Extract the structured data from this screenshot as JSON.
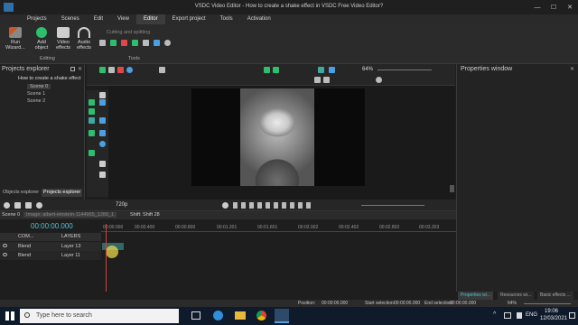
{
  "window": {
    "title": "VSDC Video Editor - How to create a shake effect in VSDC Free Video Editor?",
    "minimize": "—",
    "maximize": "☐",
    "close": "✕"
  },
  "menu": [
    "Projects",
    "Scenes",
    "Edit",
    "View",
    "Editor",
    "Export project",
    "Tools",
    "Activation"
  ],
  "ribbon": {
    "run_wizard": "Run\nWizard...",
    "add_object": "Add\nobject",
    "video_effects": "Video\neffects",
    "audio_effects": "Audio\neffects",
    "group_editing": "Editing",
    "cutting_splitting": "Cutting and splitting",
    "group_tools": "Tools"
  },
  "projects_explorer": {
    "title": "Projects explorer",
    "project": "How to create a shake effect",
    "scenes": [
      "Scene 0",
      "Scene 1",
      "Scene 2"
    ],
    "tabs": [
      "Objects explorer",
      "Projects explorer"
    ]
  },
  "properties": {
    "title": "Properties window"
  },
  "preview": {
    "zoom": "64%",
    "quality": "720p"
  },
  "timeline": {
    "breadcrumb": [
      "Scene 0",
      "Image: albert-einstein-1144965_1280_1",
      "Shift: Shift 28"
    ],
    "time": "00:00:00.000",
    "header_com": "COM...",
    "header_layers": "LAYERS",
    "ruler": [
      "00:00.000",
      "00:00.400",
      "00:00.800",
      "00:01.201",
      "00:01.601",
      "00:02.002",
      "00:02.402",
      "00:02.802",
      "00:03.203"
    ],
    "rows": [
      {
        "blend": "Blend",
        "layer": "Layer 13"
      },
      {
        "blend": "Blend",
        "layer": "Layer 11"
      }
    ]
  },
  "status": {
    "position_label": "Position:",
    "position": "00:00:00.000",
    "start_sel_label": "Start selection:",
    "start_sel": "00:00:00.000",
    "end_sel_label": "End selection:",
    "end_sel": "00:00:00.000",
    "zoom": "64%"
  },
  "right_tabs": [
    "Properties wi...",
    "Resources wi...",
    "Basic effects ..."
  ],
  "taskbar": {
    "search_placeholder": "Type here to search",
    "lang": "ENG",
    "time": "19:06",
    "date": "12/03/2021"
  },
  "colors": {
    "accent_green": "#2dbf6e",
    "accent_blue": "#1e88e5",
    "marker_yellow": "#e8d84a",
    "clip_teal": "#3fa8a0"
  }
}
